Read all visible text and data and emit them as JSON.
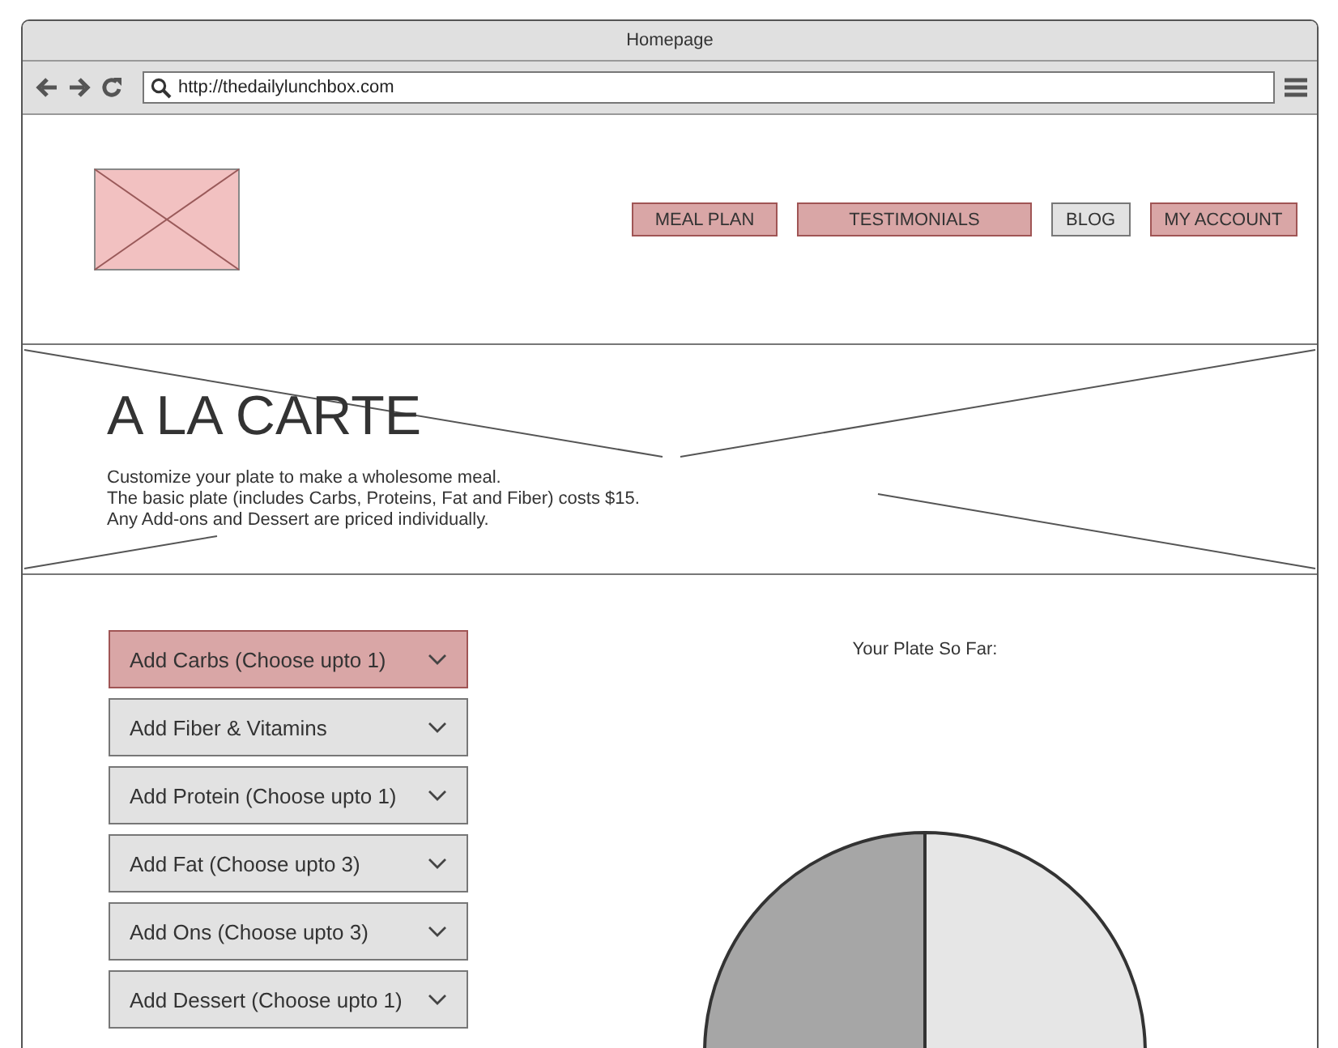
{
  "window": {
    "title": "Homepage"
  },
  "address_bar": {
    "value": "http://thedailylunchbox.com"
  },
  "nav": [
    {
      "label": "MEAL PLAN",
      "selected": true
    },
    {
      "label": "TESTIMONIALS",
      "selected": true
    },
    {
      "label": "BLOG",
      "selected": false
    },
    {
      "label": "MY ACCOUNT",
      "selected": true
    }
  ],
  "hero": {
    "title": "A LA CARTE",
    "lines": [
      "Customize your plate to make a wholesome meal.",
      "The basic plate (includes Carbs, Proteins, Fat and Fiber) costs $15.",
      "Any Add-ons and Dessert are priced individually."
    ]
  },
  "accordion": [
    {
      "label": "Add Carbs (Choose upto 1)",
      "selected": true
    },
    {
      "label": "Add Fiber & Vitamins",
      "selected": false
    },
    {
      "label": "Add Protein (Choose upto 1)",
      "selected": false
    },
    {
      "label": "Add Fat (Choose upto 3)",
      "selected": false
    },
    {
      "label": "Add Ons (Choose upto 3)",
      "selected": false
    },
    {
      "label": "Add Dessert (Choose upto 1)",
      "selected": false
    }
  ],
  "plate": {
    "heading": "Your Plate So Far:"
  }
}
